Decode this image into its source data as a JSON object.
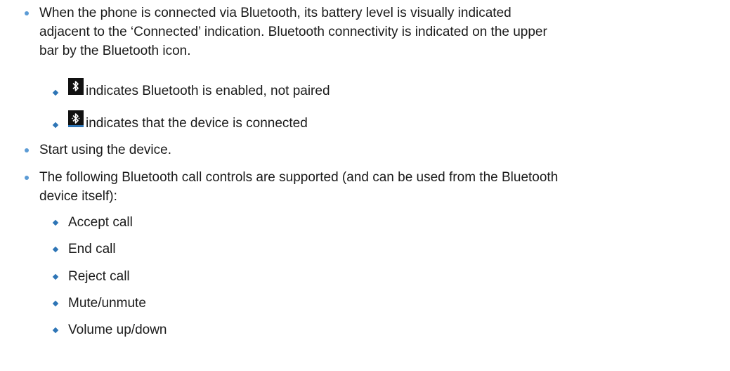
{
  "bullets": {
    "b1": "When the phone is connected via Bluetooth, its battery level is visually indicated adjacent to the ‘Connected’ indication. Bluetooth connectivity is indicated on the upper bar by the Bluetooth icon.",
    "b1_line1": "When the phone is connected via Bluetooth, its battery level is visually indicated",
    "b1_line2": "adjacent to the ‘Connected’ indication. Bluetooth connectivity is indicated on the upper",
    "b1_line3": "bar by the Bluetooth icon.",
    "b2": "Start using the device.",
    "b3_line1": "The following Bluetooth call controls are supported (and can be used from the Bluetooth",
    "b3_line2": "device itself):"
  },
  "icon_items": [
    {
      "icon": "bluetooth-enabled-icon",
      "text": "indicates Bluetooth is enabled, not paired"
    },
    {
      "icon": "bluetooth-connected-icon",
      "text": "indicates that the device is connected"
    }
  ],
  "call_controls": [
    "Accept call",
    "End call",
    "Reject call",
    "Mute/unmute",
    "Volume up/down"
  ],
  "colors": {
    "bullet": "#5b9bd5",
    "diamond": "#2e75b6"
  }
}
